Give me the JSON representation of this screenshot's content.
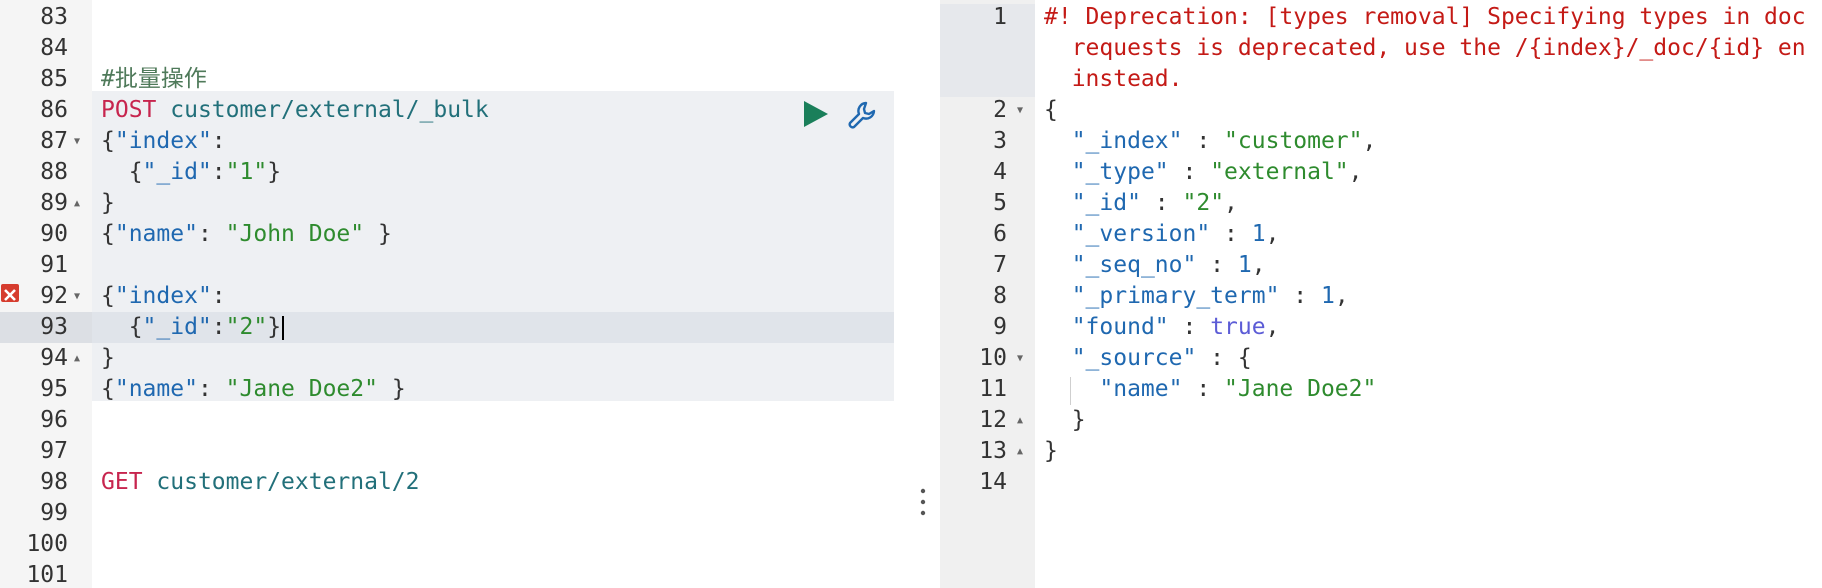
{
  "request_editor": {
    "lines": [
      {
        "num": "83",
        "fold": "",
        "tokens": []
      },
      {
        "num": "84",
        "fold": "",
        "tokens": []
      },
      {
        "num": "85",
        "fold": "",
        "tokens": [
          {
            "t": "#批量操作",
            "c": "comment"
          }
        ]
      },
      {
        "num": "86",
        "fold": "",
        "tokens": [
          {
            "t": "POST",
            "c": "method"
          },
          {
            "t": " ",
            "c": "punc"
          },
          {
            "t": "customer/external/_bulk",
            "c": "url"
          }
        ]
      },
      {
        "num": "87",
        "fold": "▼",
        "tokens": [
          {
            "t": "{",
            "c": "punc"
          },
          {
            "t": "\"index\"",
            "c": "key"
          },
          {
            "t": ":",
            "c": "punc"
          }
        ]
      },
      {
        "num": "88",
        "fold": "",
        "tokens": [
          {
            "t": "  {",
            "c": "punc"
          },
          {
            "t": "\"_id\"",
            "c": "key"
          },
          {
            "t": ":",
            "c": "punc"
          },
          {
            "t": "\"1\"",
            "c": "str"
          },
          {
            "t": "}",
            "c": "punc"
          }
        ]
      },
      {
        "num": "89",
        "fold": "▲",
        "tokens": [
          {
            "t": "}",
            "c": "punc"
          }
        ]
      },
      {
        "num": "90",
        "fold": "",
        "tokens": [
          {
            "t": "{",
            "c": "punc"
          },
          {
            "t": "\"name\"",
            "c": "key"
          },
          {
            "t": ": ",
            "c": "punc"
          },
          {
            "t": "\"John Doe\"",
            "c": "str"
          },
          {
            "t": " }",
            "c": "punc"
          }
        ]
      },
      {
        "num": "91",
        "fold": "",
        "tokens": []
      },
      {
        "num": "92",
        "fold": "▼",
        "tokens": [
          {
            "t": "{",
            "c": "punc"
          },
          {
            "t": "\"index\"",
            "c": "key"
          },
          {
            "t": ":",
            "c": "punc"
          }
        ]
      },
      {
        "num": "93",
        "fold": "",
        "tokens": [
          {
            "t": "  {",
            "c": "punc"
          },
          {
            "t": "\"_id\"",
            "c": "key"
          },
          {
            "t": ":",
            "c": "punc"
          },
          {
            "t": "\"2\"",
            "c": "str"
          },
          {
            "t": "}",
            "c": "punc"
          }
        ]
      },
      {
        "num": "94",
        "fold": "▲",
        "tokens": [
          {
            "t": "}",
            "c": "punc"
          }
        ]
      },
      {
        "num": "95",
        "fold": "",
        "tokens": [
          {
            "t": "{",
            "c": "punc"
          },
          {
            "t": "\"name\"",
            "c": "key"
          },
          {
            "t": ": ",
            "c": "punc"
          },
          {
            "t": "\"Jane Doe2\"",
            "c": "str"
          },
          {
            "t": " }",
            "c": "punc"
          }
        ]
      },
      {
        "num": "96",
        "fold": "",
        "tokens": []
      },
      {
        "num": "97",
        "fold": "",
        "tokens": []
      },
      {
        "num": "98",
        "fold": "",
        "tokens": [
          {
            "t": "GET",
            "c": "method"
          },
          {
            "t": " ",
            "c": "punc"
          },
          {
            "t": "customer/external/2",
            "c": "url"
          }
        ]
      },
      {
        "num": "99",
        "fold": "",
        "tokens": []
      },
      {
        "num": "100",
        "fold": "",
        "tokens": []
      },
      {
        "num": "101",
        "fold": "",
        "tokens": []
      }
    ],
    "active_line": "93",
    "error_line": "92",
    "selected_request_lines": [
      "86",
      "95"
    ]
  },
  "response_viewer": {
    "lines": [
      {
        "num": "1",
        "fold": "",
        "tokens": [
          {
            "t": "#! Deprecation: [types removal] Specifying types in doc",
            "c": "warn"
          }
        ]
      },
      {
        "num": "",
        "fold": "",
        "tokens": [
          {
            "t": "  requests is deprecated, use the /{index}/_doc/{id} en",
            "c": "warn"
          }
        ]
      },
      {
        "num": "",
        "fold": "",
        "tokens": [
          {
            "t": "  instead.",
            "c": "warn"
          }
        ]
      },
      {
        "num": "2",
        "fold": "▼",
        "tokens": [
          {
            "t": "{",
            "c": "punc"
          }
        ]
      },
      {
        "num": "3",
        "fold": "",
        "tokens": [
          {
            "t": "  ",
            "c": "punc"
          },
          {
            "t": "\"_index\"",
            "c": "key"
          },
          {
            "t": " : ",
            "c": "punc"
          },
          {
            "t": "\"customer\"",
            "c": "str"
          },
          {
            "t": ",",
            "c": "punc"
          }
        ]
      },
      {
        "num": "4",
        "fold": "",
        "tokens": [
          {
            "t": "  ",
            "c": "punc"
          },
          {
            "t": "\"_type\"",
            "c": "key"
          },
          {
            "t": " : ",
            "c": "punc"
          },
          {
            "t": "\"external\"",
            "c": "str"
          },
          {
            "t": ",",
            "c": "punc"
          }
        ]
      },
      {
        "num": "5",
        "fold": "",
        "tokens": [
          {
            "t": "  ",
            "c": "punc"
          },
          {
            "t": "\"_id\"",
            "c": "key"
          },
          {
            "t": " : ",
            "c": "punc"
          },
          {
            "t": "\"2\"",
            "c": "str"
          },
          {
            "t": ",",
            "c": "punc"
          }
        ]
      },
      {
        "num": "6",
        "fold": "",
        "tokens": [
          {
            "t": "  ",
            "c": "punc"
          },
          {
            "t": "\"_version\"",
            "c": "key"
          },
          {
            "t": " : ",
            "c": "punc"
          },
          {
            "t": "1",
            "c": "num"
          },
          {
            "t": ",",
            "c": "punc"
          }
        ]
      },
      {
        "num": "7",
        "fold": "",
        "tokens": [
          {
            "t": "  ",
            "c": "punc"
          },
          {
            "t": "\"_seq_no\"",
            "c": "key"
          },
          {
            "t": " : ",
            "c": "punc"
          },
          {
            "t": "1",
            "c": "num"
          },
          {
            "t": ",",
            "c": "punc"
          }
        ]
      },
      {
        "num": "8",
        "fold": "",
        "tokens": [
          {
            "t": "  ",
            "c": "punc"
          },
          {
            "t": "\"_primary_term\"",
            "c": "key"
          },
          {
            "t": " : ",
            "c": "punc"
          },
          {
            "t": "1",
            "c": "num"
          },
          {
            "t": ",",
            "c": "punc"
          }
        ]
      },
      {
        "num": "9",
        "fold": "",
        "tokens": [
          {
            "t": "  ",
            "c": "punc"
          },
          {
            "t": "\"found\"",
            "c": "key"
          },
          {
            "t": " : ",
            "c": "punc"
          },
          {
            "t": "true",
            "c": "bool"
          },
          {
            "t": ",",
            "c": "punc"
          }
        ]
      },
      {
        "num": "10",
        "fold": "▼",
        "tokens": [
          {
            "t": "  ",
            "c": "punc"
          },
          {
            "t": "\"_source\"",
            "c": "key"
          },
          {
            "t": " : {",
            "c": "punc"
          }
        ]
      },
      {
        "num": "11",
        "fold": "",
        "tokens": [
          {
            "t": "    ",
            "c": "punc"
          },
          {
            "t": "\"name\"",
            "c": "key"
          },
          {
            "t": " : ",
            "c": "punc"
          },
          {
            "t": "\"Jane Doe2\"",
            "c": "str"
          }
        ]
      },
      {
        "num": "12",
        "fold": "▲",
        "tokens": [
          {
            "t": "  }",
            "c": "punc"
          }
        ]
      },
      {
        "num": "13",
        "fold": "▲",
        "tokens": [
          {
            "t": "}",
            "c": "punc"
          }
        ]
      },
      {
        "num": "14",
        "fold": "",
        "tokens": []
      }
    ]
  },
  "icons": {
    "play": "play-icon",
    "wrench": "wrench-icon",
    "error": "error-icon",
    "splitter": "vertical-dots-icon"
  },
  "colors": {
    "play": "#1a7f5a",
    "wrench": "#1f68b0",
    "error": "#d63c2e",
    "warning_text": "#c41a16"
  }
}
